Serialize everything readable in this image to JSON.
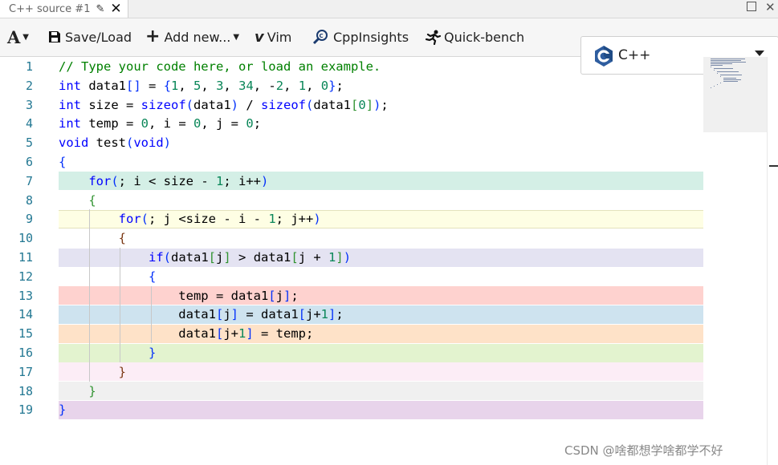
{
  "tab": {
    "title": "C++ source #1"
  },
  "toolbar": {
    "font_label": "A",
    "save_load": "Save/Load",
    "add_new": "Add new...",
    "vim": "Vim",
    "cppinsights": "CppInsights",
    "quick_bench": "Quick-bench"
  },
  "language": {
    "selected": "C++"
  },
  "editor": {
    "line_numbers": [
      "1",
      "2",
      "3",
      "4",
      "5",
      "6",
      "7",
      "8",
      "9",
      "10",
      "11",
      "12",
      "13",
      "14",
      "15",
      "16",
      "17",
      "18",
      "19"
    ],
    "lines": [
      "// Type your code here, or load an example.",
      "int data1[] = {1, 5, 3, 34, -2, 1, 0};",
      "int size = sizeof(data1) / sizeof(data1[0]);",
      "int temp = 0, i = 0, j = 0;",
      "void test(void)",
      "{",
      "    for(; i < size - 1; i++)",
      "    {",
      "        for(; j <size - i - 1; j++)",
      "        {",
      "            if(data1[j] > data1[j + 1])",
      "            {",
      "                temp = data1[j];",
      "                data1[j] = data1[j+1];",
      "                data1[j+1] = temp;",
      "            }",
      "        }",
      "    }",
      "}"
    ],
    "highlight_colors": {
      "7": "#d4efe6",
      "9": "#fefee4",
      "11": "#e4e3f2",
      "13": "#fed2cf",
      "14": "#cee3ef",
      "15": "#fee2c8",
      "16": "#e3f3cf",
      "17": "#fcedf6",
      "18": "#f0f0f0",
      "19": "#e8d4eb"
    }
  },
  "watermark": "CSDN @啥都想学啥都学不好"
}
